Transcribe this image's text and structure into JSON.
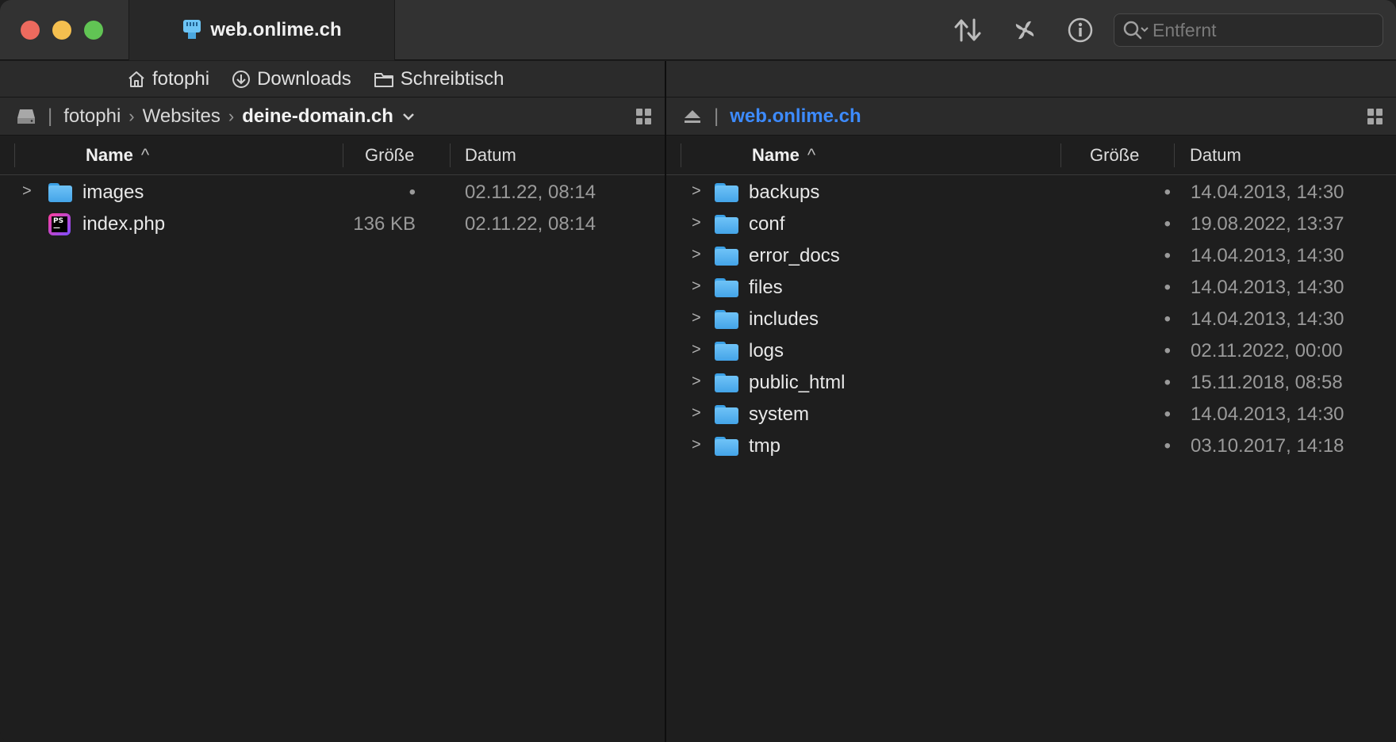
{
  "window": {
    "tab_title": "web.onlime.ch"
  },
  "toolbar": {
    "transfer_icon": "arrow-up-down-icon",
    "activity_icon": "activity-fan-icon",
    "info_icon": "info-icon",
    "search_placeholder": "Entfernt"
  },
  "left": {
    "favorites": [
      {
        "label": "fotophi",
        "icon": "home-icon"
      },
      {
        "label": "Downloads",
        "icon": "download-icon"
      },
      {
        "label": "Schreibtisch",
        "icon": "folder-icon"
      }
    ],
    "path": {
      "segments": [
        "fotophi",
        "Websites",
        "deine-domain.ch"
      ]
    },
    "columns": {
      "name": "Name",
      "size": "Größe",
      "date": "Datum"
    },
    "files": [
      {
        "name": "images",
        "size": "•",
        "date": "02.11.22, 08:14",
        "type": "folder"
      },
      {
        "name": "index.php",
        "size": "136 KB",
        "date": "02.11.22, 08:14",
        "type": "php"
      }
    ]
  },
  "right": {
    "path": {
      "server": "web.onlime.ch"
    },
    "columns": {
      "name": "Name",
      "size": "Größe",
      "date": "Datum"
    },
    "files": [
      {
        "name": "backups",
        "size": "•",
        "date": "14.04.2013, 14:30"
      },
      {
        "name": "conf",
        "size": "•",
        "date": "19.08.2022, 13:37"
      },
      {
        "name": "error_docs",
        "size": "•",
        "date": "14.04.2013, 14:30"
      },
      {
        "name": "files",
        "size": "•",
        "date": "14.04.2013, 14:30"
      },
      {
        "name": "includes",
        "size": "•",
        "date": "14.04.2013, 14:30"
      },
      {
        "name": "logs",
        "size": "•",
        "date": "02.11.2022, 00:00"
      },
      {
        "name": "public_html",
        "size": "•",
        "date": "15.11.2018, 08:58"
      },
      {
        "name": "system",
        "size": "•",
        "date": "14.04.2013, 14:30"
      },
      {
        "name": "tmp",
        "size": "•",
        "date": "03.10.2017, 14:18"
      }
    ]
  }
}
